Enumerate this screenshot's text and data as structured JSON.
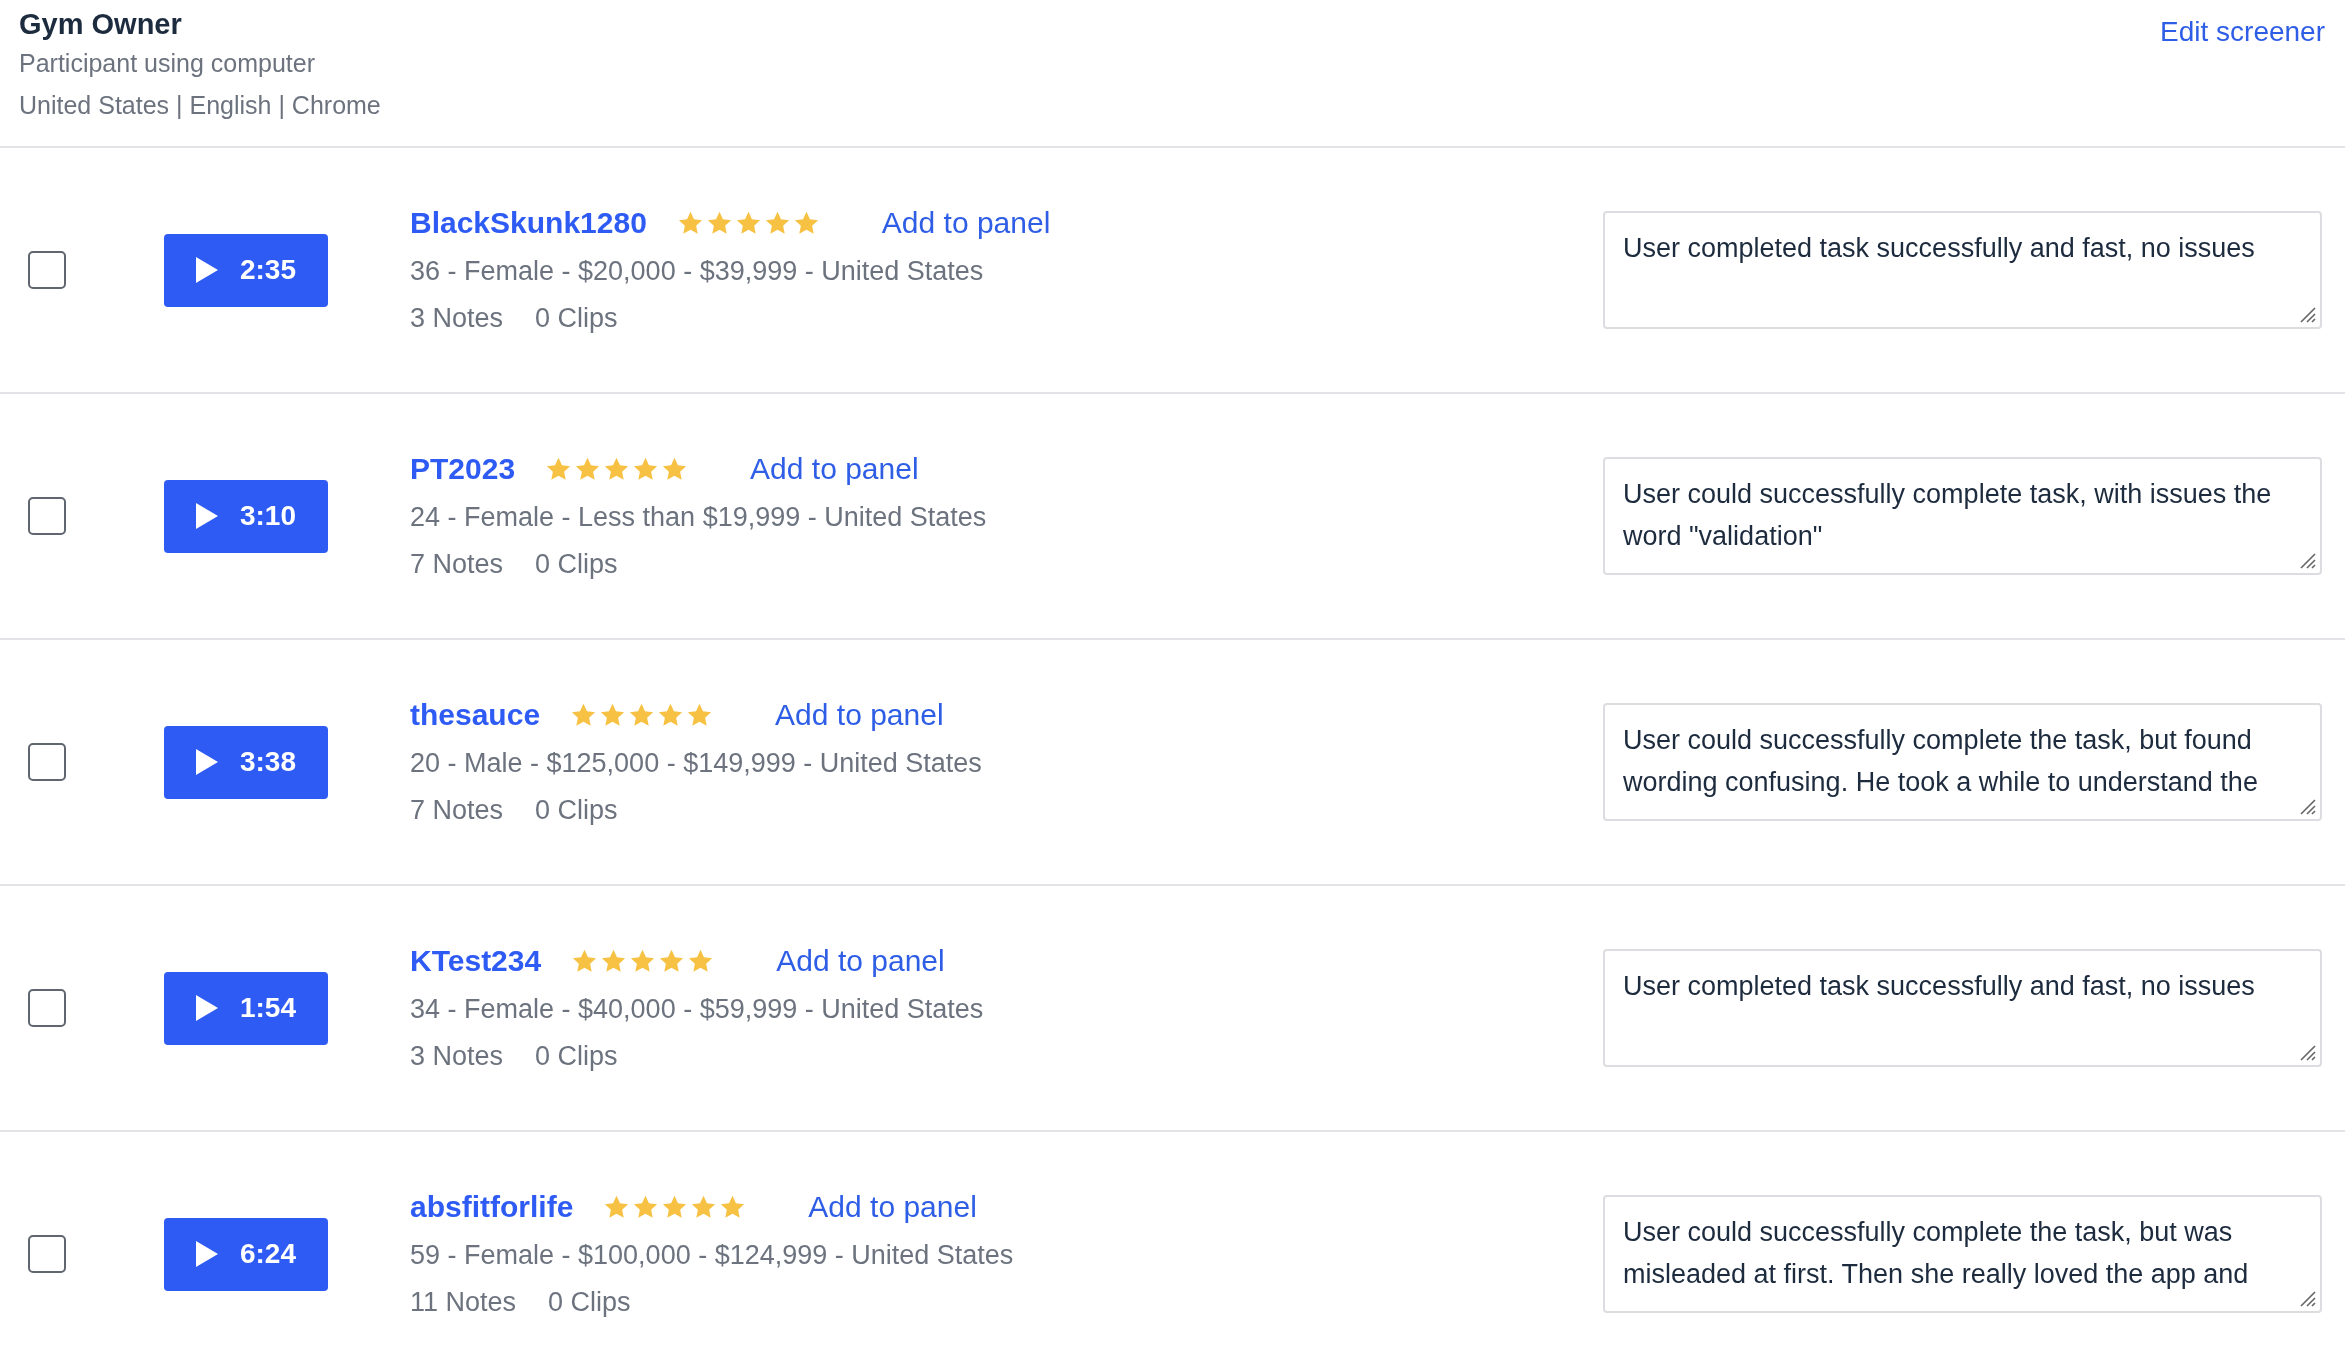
{
  "header": {
    "title": "Gym Owner",
    "subtitle": "Participant using computer",
    "meta": "United States | English | Chrome",
    "action": "Edit screener"
  },
  "participants": [
    {
      "checked": false,
      "duration": "2:35",
      "name": "BlackSkunk1280",
      "stars": 5,
      "add": "Add to panel",
      "details": "36 - Female - $20,000 - $39,999 - United States",
      "notes": "3 Notes",
      "clips": "0 Clips",
      "note": "User completed task successfully and fast, no issues"
    },
    {
      "checked": false,
      "duration": "3:10",
      "name": "PT2023",
      "stars": 5,
      "add": "Add to panel",
      "details": "24 - Female - Less than $19,999 - United States",
      "notes": "7 Notes",
      "clips": "0 Clips",
      "note": "User could successfully complete task, with issues the word \"validation\""
    },
    {
      "checked": false,
      "duration": "3:38",
      "name": "thesauce",
      "stars": 5,
      "add": "Add to panel",
      "details": "20 - Male - $125,000 - $149,999 - United States",
      "notes": "7 Notes",
      "clips": "0 Clips",
      "note": "User could successfully complete the task, but found wording confusing. He took a while to understand the"
    },
    {
      "checked": false,
      "duration": "1:54",
      "name": "KTest234",
      "stars": 5,
      "add": "Add to panel",
      "details": "34 - Female - $40,000 - $59,999 - United States",
      "notes": "3 Notes",
      "clips": "0 Clips",
      "note": "User completed task successfully and fast, no issues"
    },
    {
      "checked": false,
      "duration": "6:24",
      "name": "absfitforlife",
      "stars": 5,
      "add": "Add to panel",
      "details": "59 - Female - $100,000 - $124,999 - United States",
      "notes": "11 Notes",
      "clips": "0 Clips",
      "note": "User could successfully complete the task, but was misleaded at first. Then she really loved the app and"
    }
  ]
}
